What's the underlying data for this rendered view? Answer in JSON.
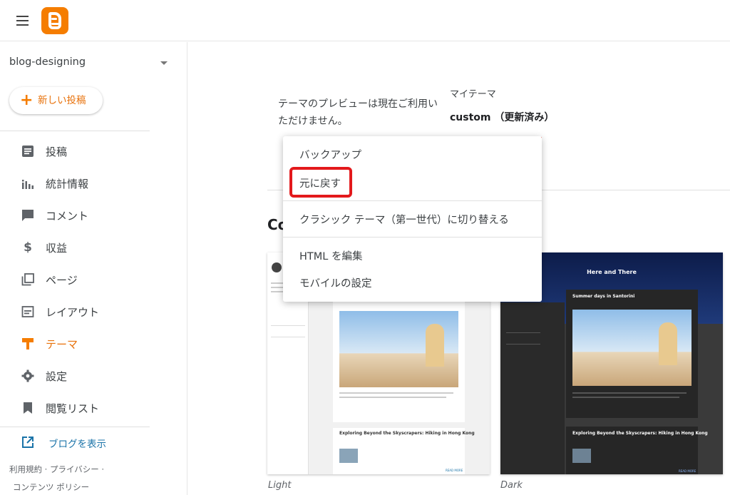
{
  "header": {
    "menu_icon": "hamburger-menu-icon",
    "logo_icon": "blogger-logo-icon",
    "brand_color": "#f57d00"
  },
  "sidebar": {
    "blog_name": "blog-designing",
    "new_post_label": "新しい投稿",
    "items": [
      {
        "label": "投稿",
        "icon": "posts-icon",
        "active": false
      },
      {
        "label": "統計情報",
        "icon": "stats-icon",
        "active": false
      },
      {
        "label": "コメント",
        "icon": "comment-icon",
        "active": false
      },
      {
        "label": "収益",
        "icon": "dollar-icon",
        "active": false
      },
      {
        "label": "ページ",
        "icon": "pages-icon",
        "active": false
      },
      {
        "label": "レイアウト",
        "icon": "layout-icon",
        "active": false
      },
      {
        "label": "テーマ",
        "icon": "theme-paint-roller-icon",
        "active": true
      },
      {
        "label": "設定",
        "icon": "gear-icon",
        "active": false
      },
      {
        "label": "閲覧リスト",
        "icon": "bookmark-icon",
        "active": false
      }
    ],
    "view_blog_label": "ブログを表示",
    "footer_line1": "利用規約 · プライバシー ·",
    "footer_line2": "コンテンツ ポリシー"
  },
  "main": {
    "preview_message": "テーマのプレビューは現在ご利用いただけません。",
    "my_theme_label": "マイテーマ",
    "theme_name": "custom （更新済み）",
    "section_title": "Co",
    "dropdown": {
      "items": [
        {
          "label": "バックアップ"
        },
        {
          "label": "元に戻す",
          "highlighted": true
        },
        {
          "label": "クラシック テーマ（第一世代）に切り替える"
        },
        {
          "label": "HTML を編集"
        },
        {
          "label": "モバイルの設定"
        }
      ]
    },
    "themes": [
      {
        "caption": "Light",
        "preview_post_1": "Exploring Beyond the Skyscrapers: Hiking in Hong Kong",
        "preview_more": "READ MORE"
      },
      {
        "caption": "Dark",
        "preview_blog_title": "Here and There",
        "preview_post_1": "Summer days in Santorini",
        "preview_post_2": "Exploring Beyond the Skyscrapers: Hiking in Hong Kong",
        "preview_more": "READ MORE"
      }
    ]
  },
  "colors": {
    "accent": "#e8710a",
    "link": "#1a73a8",
    "highlight_border": "#e3191c"
  }
}
